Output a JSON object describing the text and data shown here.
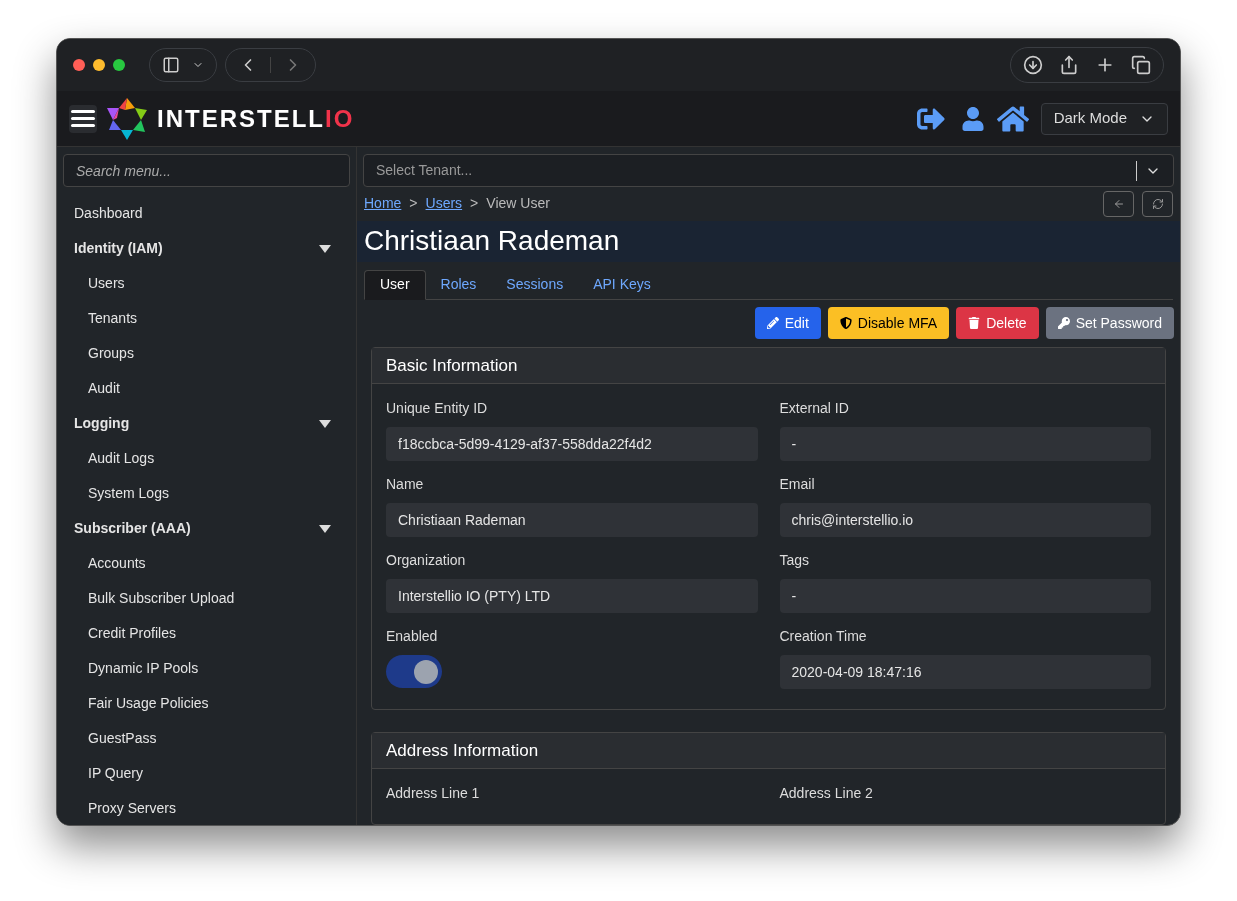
{
  "brand": {
    "text": "INTERSTELL",
    "accent": "IO"
  },
  "theme_select": {
    "value": "Dark Mode"
  },
  "sidebar": {
    "search": {
      "placeholder": "Search menu..."
    },
    "items": [
      {
        "label": "Dashboard"
      },
      {
        "label": "Identity (IAM)",
        "expanded": true,
        "children": [
          {
            "label": "Users"
          },
          {
            "label": "Tenants"
          },
          {
            "label": "Groups"
          },
          {
            "label": "Audit"
          }
        ]
      },
      {
        "label": "Logging",
        "expanded": true,
        "children": [
          {
            "label": "Audit Logs"
          },
          {
            "label": "System Logs"
          }
        ]
      },
      {
        "label": "Subscriber (AAA)",
        "expanded": true,
        "children": [
          {
            "label": "Accounts"
          },
          {
            "label": "Bulk Subscriber Upload"
          },
          {
            "label": "Credit Profiles"
          },
          {
            "label": "Dynamic IP Pools"
          },
          {
            "label": "Fair Usage Policies"
          },
          {
            "label": "GuestPass"
          },
          {
            "label": "IP Query"
          },
          {
            "label": "Proxy Servers"
          }
        ]
      }
    ]
  },
  "tenant_select": {
    "placeholder": "Select Tenant..."
  },
  "breadcrumb": [
    {
      "label": "Home",
      "kind": "link"
    },
    {
      "label": ">",
      "kind": "separator"
    },
    {
      "label": "Users",
      "kind": "link"
    },
    {
      "label": ">",
      "kind": "separator"
    },
    {
      "label": "View User",
      "kind": "current"
    }
  ],
  "title": "Christiaan Rademan",
  "tabs": [
    {
      "label": "User",
      "selected": true
    },
    {
      "label": "Roles",
      "selected": false
    },
    {
      "label": "Sessions",
      "selected": false
    },
    {
      "label": "API Keys",
      "selected": false
    }
  ],
  "actions": [
    {
      "label": "Edit",
      "kind": "edit"
    },
    {
      "label": "Disable MFA",
      "kind": "mfa"
    },
    {
      "label": "Delete",
      "kind": "delete"
    },
    {
      "label": "Set Password",
      "kind": "password"
    }
  ],
  "cards": [
    {
      "title": "Basic Information",
      "fields": [
        {
          "label": "Unique Entity ID",
          "kind": "text",
          "value": "f18ccbca-5d99-4129-af37-558dda22f4d2"
        },
        {
          "label": "External ID",
          "kind": "text",
          "value": "-"
        },
        {
          "label": "Name",
          "kind": "text",
          "value": "Christiaan Rademan"
        },
        {
          "label": "Email",
          "kind": "text",
          "value": "chris@interstellio.io"
        },
        {
          "label": "Organization",
          "kind": "text",
          "value": "Interstellio IO (PTY) LTD"
        },
        {
          "label": "Tags",
          "kind": "text",
          "value": "-"
        },
        {
          "label": "Enabled",
          "kind": "toggle",
          "on": true
        },
        {
          "label": "Creation Time",
          "kind": "text",
          "value": "2020-04-09 18:47:16"
        }
      ]
    },
    {
      "title": "Address Information",
      "fields": [
        {
          "label": "Address Line 1",
          "kind": "label"
        },
        {
          "label": "Address Line 2",
          "kind": "label"
        }
      ]
    }
  ]
}
